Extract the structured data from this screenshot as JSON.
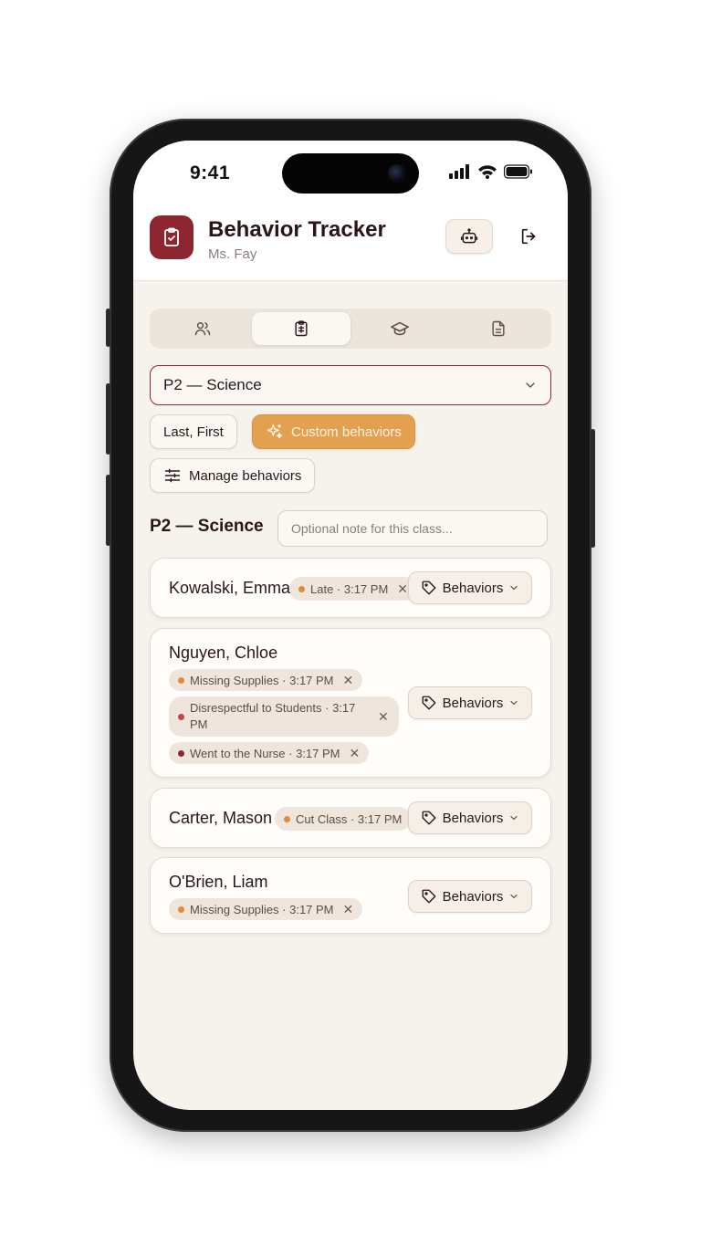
{
  "status": {
    "time": "9:41"
  },
  "header": {
    "title": "Behavior Tracker",
    "subtitle": "Ms. Fay"
  },
  "tabs": [
    {
      "icon": "users-icon",
      "active": false
    },
    {
      "icon": "clipboard-icon",
      "active": true
    },
    {
      "icon": "graduation-cap-icon",
      "active": false
    },
    {
      "icon": "document-icon",
      "active": false
    }
  ],
  "class_select": {
    "value": "P2 — Science"
  },
  "controls": {
    "sort_label": "Last, First",
    "custom_label": "Custom behaviors",
    "manage_label": "Manage behaviors"
  },
  "section": {
    "title": "P2 — Science",
    "note_placeholder": "Optional note for this class..."
  },
  "students": [
    {
      "name": "Kowalski, Emma",
      "tags": [
        {
          "text": "Late · 3:17 PM",
          "color": "#e08a3c"
        }
      ],
      "button": "Behaviors"
    },
    {
      "name": "Nguyen, Chloe",
      "tags": [
        {
          "text": "Missing Supplies · 3:17 PM",
          "color": "#e08a3c"
        },
        {
          "text": "Disrespectful to Students · 3:17",
          "text2": "PM",
          "color": "#c6434a"
        },
        {
          "text": "Went to the Nurse · 3:17 PM",
          "color": "#8e2631"
        }
      ],
      "button": "Behaviors"
    },
    {
      "name": "Carter, Mason",
      "tags": [
        {
          "text": "Cut Class · 3:17 PM",
          "color": "#e08a3c"
        }
      ],
      "button": "Behaviors"
    },
    {
      "name": "O'Brien, Liam",
      "tags": [
        {
          "text": "Missing Supplies · 3:17 PM",
          "color": "#e08a3c"
        }
      ],
      "button": "Behaviors"
    }
  ],
  "colors": {
    "brand": "#8e2631",
    "accent": "#e4a051",
    "background": "#f6f2ec"
  }
}
